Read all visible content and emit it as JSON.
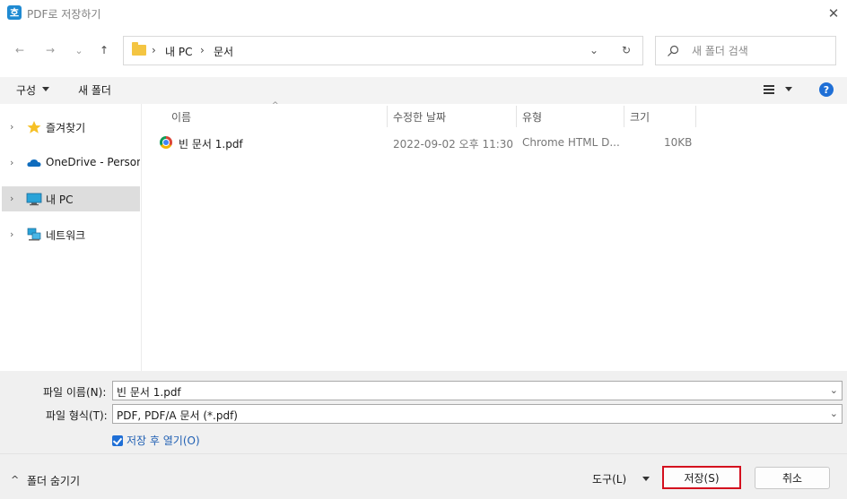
{
  "window": {
    "title": "PDF로 저장하기",
    "app_icon_letter": "호",
    "close_glyph": "✕"
  },
  "nav": {
    "back_glyph": "←",
    "forward_glyph": "→",
    "recent_glyph": "⌄",
    "up_glyph": "↑",
    "breadcrumb": [
      "내 PC",
      "문서"
    ],
    "separator": "›",
    "dropdown_glyph": "⌄",
    "refresh_glyph": "↻"
  },
  "search": {
    "placeholder": "새 폴더 검색",
    "icon": "search-icon"
  },
  "toolbar": {
    "organize_label": "구성",
    "new_folder_label": "새 폴더",
    "help_label": "?"
  },
  "sidebar": {
    "items": [
      {
        "label": "즐겨찾기",
        "icon": "star-icon",
        "selected": false
      },
      {
        "label": "OneDrive - Persona",
        "icon": "cloud-icon",
        "selected": false
      },
      {
        "label": "내 PC",
        "icon": "computer-icon",
        "selected": true
      },
      {
        "label": "네트워크",
        "icon": "network-icon",
        "selected": false
      }
    ],
    "chevron": "›"
  },
  "filelist": {
    "columns": [
      "이름",
      "수정한 날짜",
      "유형",
      "크기"
    ],
    "sort_glyph": "^",
    "rows": [
      {
        "name": "빈 문서 1.pdf",
        "modified": "2022-09-02 오후 11:30",
        "type": "Chrome HTML D...",
        "size": "10KB",
        "icon": "chrome-icon"
      }
    ]
  },
  "form": {
    "filename_label": "파일 이름(N):",
    "filename_value": "빈 문서 1.pdf",
    "filetype_label": "파일 형식(T):",
    "filetype_value": "PDF, PDF/A 문서 (*.pdf)",
    "open_after_label": "저장 후 열기(O)",
    "open_after_checked": true,
    "field_chevron": "⌄"
  },
  "footer": {
    "hide_folders_label": "폴더 숨기기",
    "hide_chevron": "^",
    "tools_label": "도구(L)",
    "save_label": "저장(S)",
    "cancel_label": "취소"
  },
  "colors": {
    "accent": "#1f6fd6",
    "highlight_border": "#d40f1e",
    "selected_bg": "#dddddd",
    "folder": "#f4c542"
  }
}
